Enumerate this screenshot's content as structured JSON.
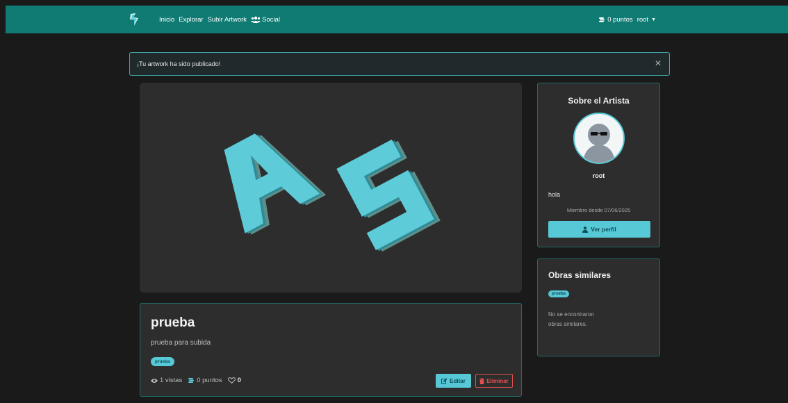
{
  "nav": {
    "links": [
      "Inicio",
      "Explorar",
      "Subir Artwork"
    ],
    "social": "Social",
    "points": "0 puntos",
    "user": "root"
  },
  "alert": {
    "message": "¡Tu artwork ha sido publicado!",
    "close": "×"
  },
  "artwork": {
    "title": "prueba",
    "description": "prueba para subida",
    "tag": "prueba",
    "views": "1 vistas",
    "points": "0 puntos",
    "likes": "0",
    "edit_label": "Editar",
    "delete_label": "Eliminar"
  },
  "artist": {
    "heading": "Sobre el Artista",
    "name": "root",
    "bio": "hola",
    "member_since": "Miembro desde 07/06/2025",
    "profile_button": "Ver perfil"
  },
  "similar": {
    "heading": "Obras similares",
    "tag": "prueba",
    "empty": "No se encontraron obras similares."
  },
  "colors": {
    "navbar": "#0f7b73",
    "accent": "#57c8d6",
    "danger": "#e05050",
    "background": "#1a1a1a",
    "card": "#2d2d2d"
  }
}
